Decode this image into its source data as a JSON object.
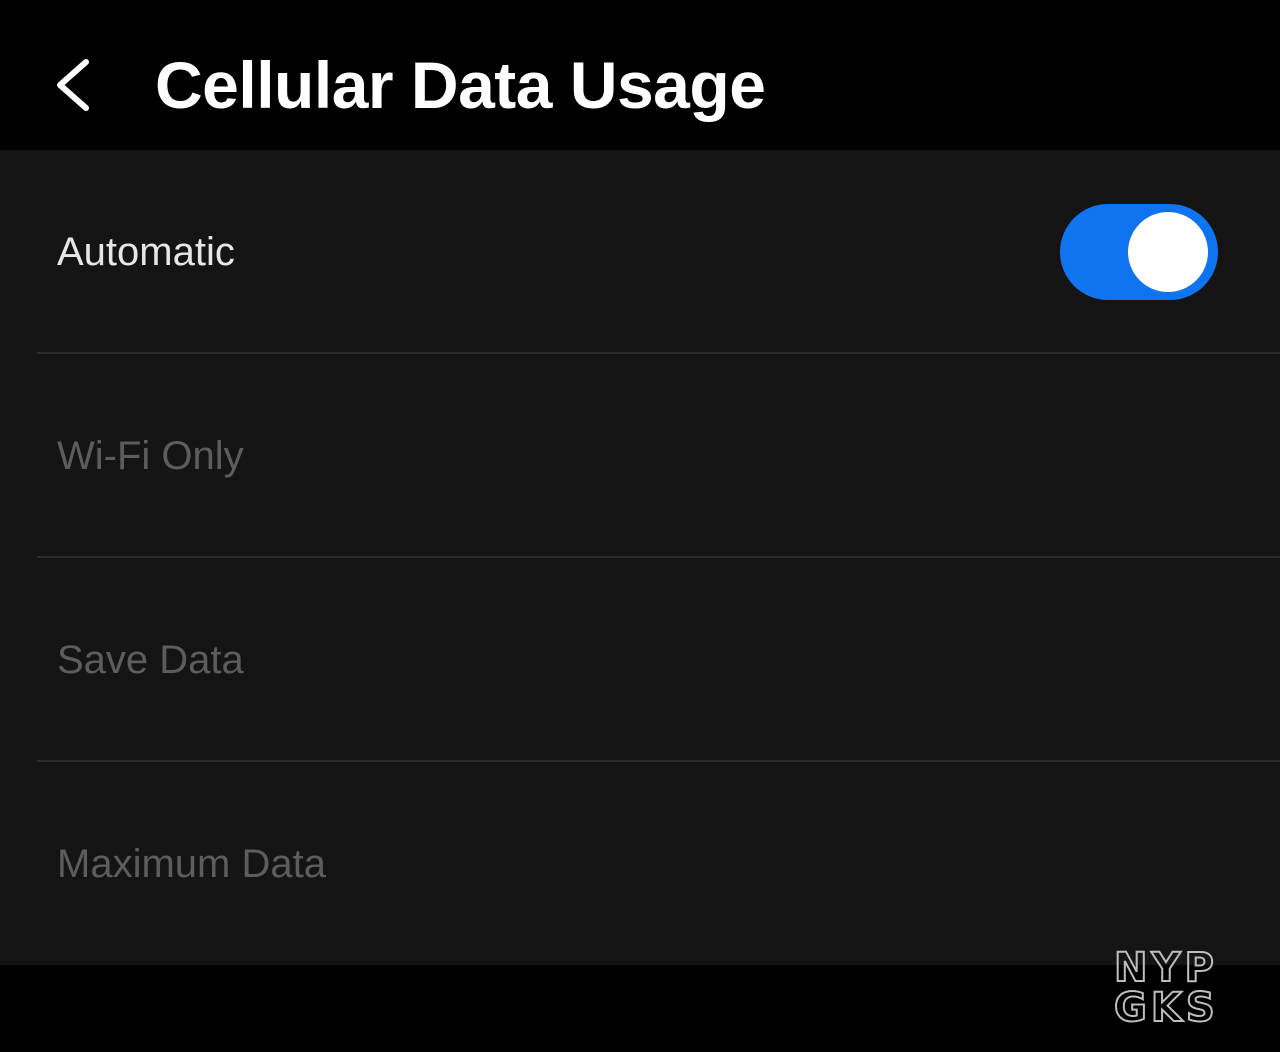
{
  "header": {
    "title": "Cellular Data Usage",
    "back_icon": "chevron-left-icon"
  },
  "settings": [
    {
      "label": "Automatic",
      "enabled": true,
      "has_toggle": true,
      "toggle_on": true
    },
    {
      "label": "Wi-Fi Only",
      "enabled": false
    },
    {
      "label": "Save Data",
      "enabled": false
    },
    {
      "label": "Maximum Data",
      "enabled": false
    }
  ],
  "colors": {
    "background": "#000000",
    "list_background": "#141414",
    "divider": "#2a2a2a",
    "label_enabled": "#e6e6e6",
    "label_disabled": "#5c5c5c",
    "toggle_on": "#0f74ef",
    "toggle_knob": "#ffffff",
    "title": "#ffffff"
  },
  "watermark": {
    "line1": "NYP",
    "line2": "GKS"
  }
}
